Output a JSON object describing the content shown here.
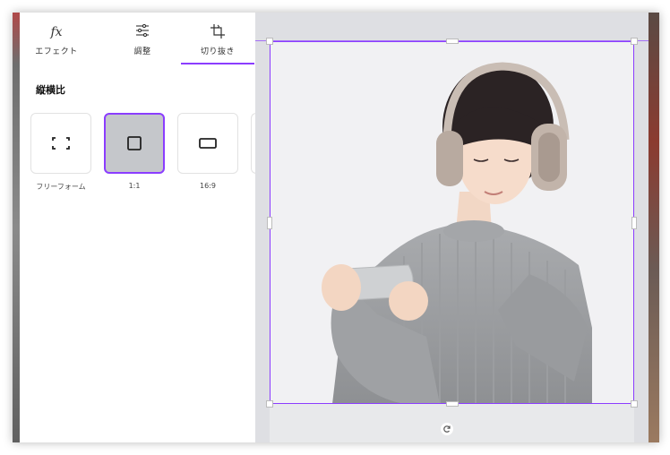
{
  "tabs": [
    {
      "label": "エフェクト",
      "icon": "fx-icon",
      "icon_text": "fx"
    },
    {
      "label": "調整",
      "icon": "sliders-icon"
    },
    {
      "label": "切り抜き",
      "icon": "crop-icon"
    }
  ],
  "active_tab": "切り抜き",
  "aspect_section": {
    "title": "縦横比",
    "options": [
      {
        "label": "フリーフォーム",
        "icon": "freeform-icon"
      },
      {
        "label": "1:1",
        "icon": "square-icon"
      },
      {
        "label": "16:9",
        "icon": "widescreen-icon"
      }
    ],
    "selected": "1:1"
  },
  "canvas": {
    "image": "woman-headphones-smartphone-photo",
    "rotate_icon": "rotate-icon"
  },
  "colors": {
    "accent": "#8b3dff",
    "canvas_bg": "#dedfe3",
    "selected_card": "#c5c7cb"
  }
}
